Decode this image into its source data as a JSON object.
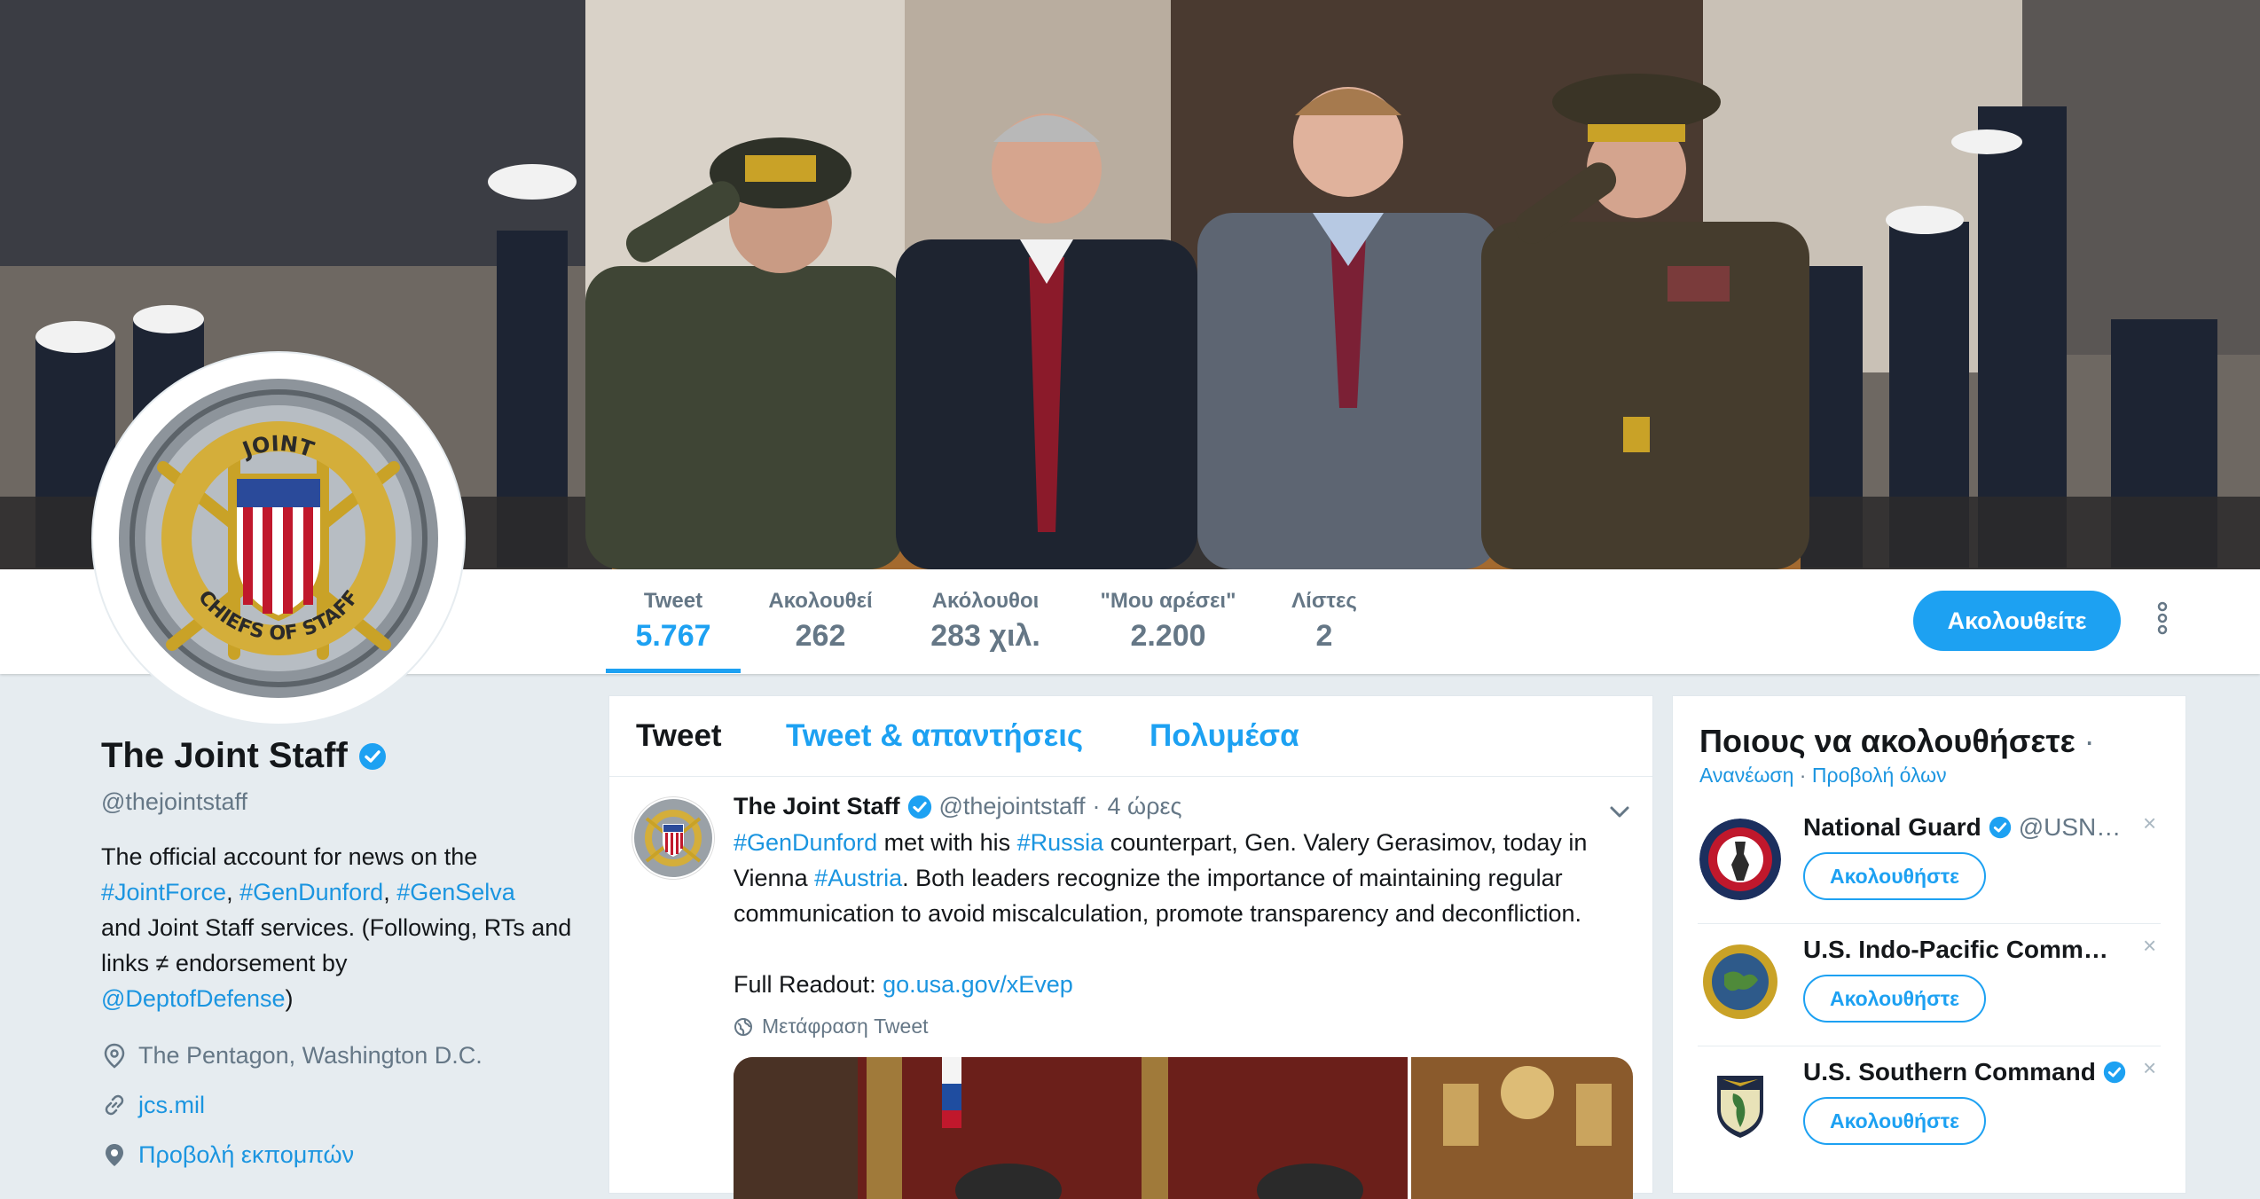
{
  "nav": {
    "stats": [
      {
        "label": "Tweet",
        "value": "5.767"
      },
      {
        "label": "Ακολουθεί",
        "value": "262"
      },
      {
        "label": "Ακόλουθοι",
        "value": "283 χιλ."
      },
      {
        "label": "\"Μου αρέσει\"",
        "value": "2.200"
      },
      {
        "label": "Λίστες",
        "value": "2"
      }
    ],
    "following_label": "Ακολουθείτε"
  },
  "avatar": {
    "ring_top": "JOINT",
    "ring_bottom": "CHIEFS OF STAFF"
  },
  "profile": {
    "name": "The Joint Staff",
    "handle": "@thejointstaff",
    "bio": {
      "text1": "The official account for news on the",
      "tag1": "#JointForce",
      "sep1": ", ",
      "tag2": "#GenDunford",
      "sep2": ", ",
      "tag3": "#GenSelva",
      "text2": "and Joint Staff services. (Following, RTs and links ≠ endorsement by",
      "mention": "@DeptofDefense",
      "text3": ")"
    },
    "location": "The Pentagon, Washington D.C.",
    "website": "jcs.mil",
    "broadcasts": "Προβολή εκπομπών"
  },
  "timeline": {
    "tabs": [
      "Tweet",
      "Tweet & απαντήσεις",
      "Πολυμέσα"
    ],
    "tweet": {
      "name": "The Joint Staff",
      "handle": "@thejointstaff",
      "dot": "·",
      "time": "4 ώρες",
      "t_tag1": "#GenDunford",
      "t_text1": " met with his ",
      "t_tag2": "#Russia",
      "t_text2": " counterpart, Gen. Valery Gerasimov, today in Vienna ",
      "t_tag3": "#Austria",
      "t_text3": ". Both leaders recognize the importance of maintaining regular communication to avoid miscalculation, promote transparency and deconfliction.",
      "readout_label": "Full Readout: ",
      "readout_link": "go.usa.gov/xEvep",
      "translate": "Μετάφραση Tweet"
    }
  },
  "who_to_follow": {
    "title": "Ποιους να ακολουθήσετε",
    "title_dot": "·",
    "refresh": "Ανανέωση",
    "link_sep": " · ",
    "view_all": "Προβολή όλων",
    "dismiss": "×",
    "follow_label": "Ακολουθήστε",
    "items": [
      {
        "name": "National Guard",
        "handle": "@USN…",
        "verified": true
      },
      {
        "name": "U.S. Indo-Pacific Comm…",
        "handle": "",
        "verified": false
      },
      {
        "name": "U.S. Southern Command",
        "handle": "",
        "verified": true
      }
    ]
  },
  "colors": {
    "accent": "#1da1f2",
    "link": "#1b95e0",
    "muted": "#657786",
    "background": "#e6ecf0"
  }
}
